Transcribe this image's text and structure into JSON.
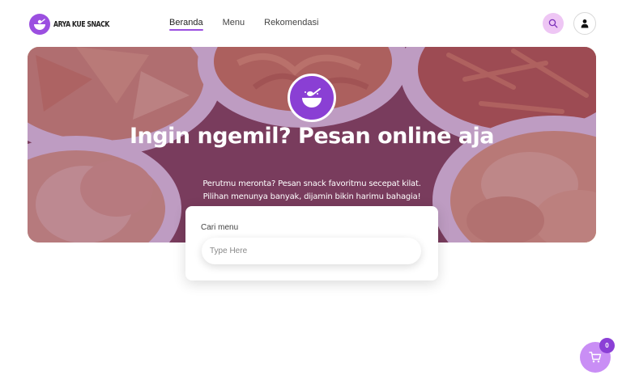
{
  "brand": {
    "name": "ARYA KUE SNACK"
  },
  "nav": {
    "items": [
      {
        "label": "Beranda",
        "active": true
      },
      {
        "label": "Menu",
        "active": false
      },
      {
        "label": "Rekomendasi",
        "active": false
      }
    ]
  },
  "header": {
    "search_icon": "search-icon",
    "user_icon": "user-icon"
  },
  "hero": {
    "title": "Ingin ngemil? Pesan online aja",
    "subtitle_line1": "Perutmu meronta? Pesan snack favoritmu secepat kilat.",
    "subtitle_line2": "Pilihan menunya banyak, dijamin bikin harimu bahagia!",
    "icon": "bowl-spoon-icon"
  },
  "search": {
    "label": "Cari menu",
    "placeholder": "Type Here",
    "value": ""
  },
  "cart": {
    "count": "0",
    "icon": "cart-icon"
  },
  "colors": {
    "accent": "#9b4fe0",
    "search_bg": "#eec6f4",
    "cart_bg": "#c98ef5",
    "badge": "#8b3fd6"
  }
}
